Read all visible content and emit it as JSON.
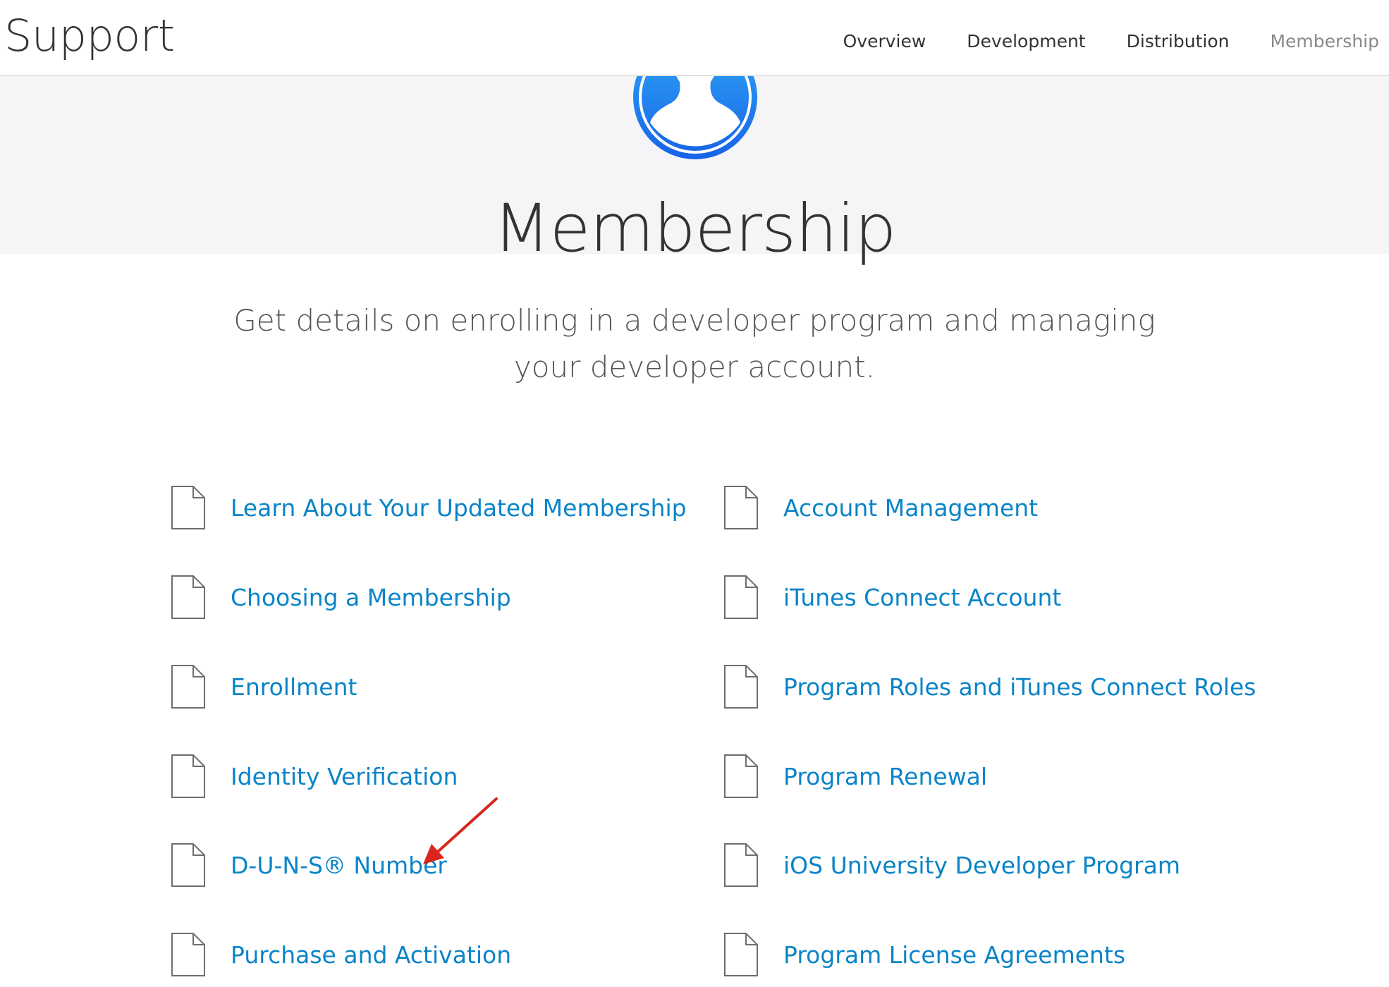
{
  "header": {
    "brand": "Support",
    "nav": [
      {
        "label": "Overview"
      },
      {
        "label": "Development"
      },
      {
        "label": "Distribution"
      },
      {
        "label": "Membership"
      }
    ]
  },
  "hero": {
    "icon": "developer-profile-icon",
    "title": "Membership",
    "subtitle": "Get details on enrolling in a developer program and managing your developer account."
  },
  "links": {
    "left": [
      {
        "label": "Learn About Your Updated Membership",
        "icon": "document-icon"
      },
      {
        "label": "Choosing a Membership",
        "icon": "document-icon"
      },
      {
        "label": "Enrollment",
        "icon": "document-icon"
      },
      {
        "label": "Identity Verification",
        "icon": "document-icon"
      },
      {
        "label": "D-U-N-S® Number",
        "icon": "document-icon"
      },
      {
        "label": "Purchase and Activation",
        "icon": "document-icon"
      }
    ],
    "right": [
      {
        "label": "Account Management",
        "icon": "document-icon"
      },
      {
        "label": "iTunes Connect Account",
        "icon": "document-icon"
      },
      {
        "label": "Program Roles and iTunes Connect Roles",
        "icon": "document-icon"
      },
      {
        "label": "Program Renewal",
        "icon": "document-icon"
      },
      {
        "label": "iOS University Developer Program",
        "icon": "document-icon"
      },
      {
        "label": "Program License Agreements",
        "icon": "document-icon"
      }
    ]
  },
  "annotation": {
    "icon": "red-arrow-icon",
    "color": "#d9261c"
  },
  "colors": {
    "link": "#0a84c8",
    "hero_icon_blue": "#1a7cf0",
    "hero_bg": "#f5f5f7"
  }
}
